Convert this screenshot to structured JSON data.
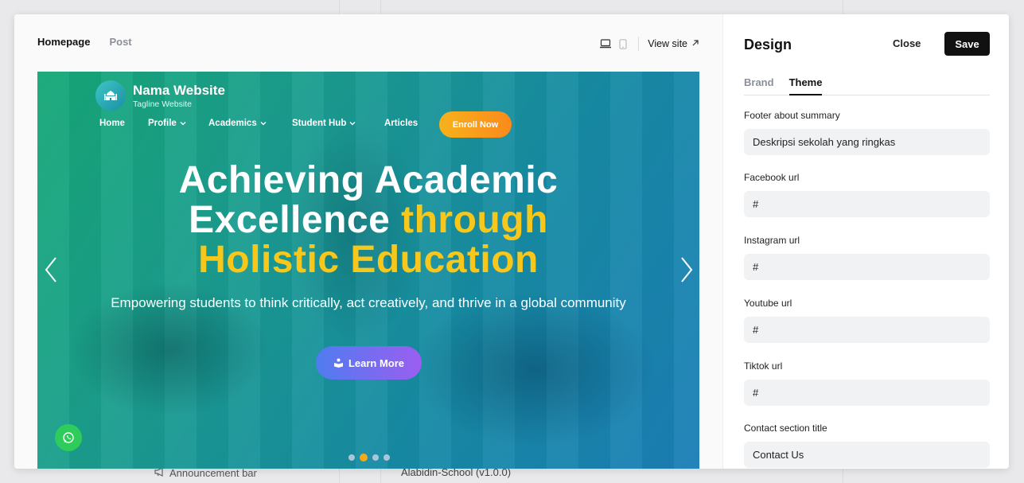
{
  "background": {
    "announcement_label": "Announcement bar",
    "version_text": "Alabidin-School (v1.0.0)"
  },
  "preview": {
    "tabs": [
      {
        "label": "Homepage",
        "active": true
      },
      {
        "label": "Post",
        "active": false
      }
    ],
    "view_site_label": "View site"
  },
  "hero": {
    "site_name": "Nama Website",
    "tagline": "Tagline Website",
    "nav": [
      {
        "label": "Home",
        "has_dropdown": false
      },
      {
        "label": "Profile",
        "has_dropdown": true
      },
      {
        "label": "Academics",
        "has_dropdown": true
      },
      {
        "label": "Student Hub",
        "has_dropdown": true
      },
      {
        "label": "Articles",
        "has_dropdown": false
      }
    ],
    "enroll_label": "Enroll Now",
    "headline_part1": "Achieving Academic",
    "headline_part2": "Excellence",
    "headline_highlight1": "through",
    "headline_highlight2": "Holistic Education",
    "subtext": "Empowering students to think critically, act creatively, and thrive in a global community",
    "learn_more_label": "Learn More",
    "slide_count": 4,
    "active_slide": 2,
    "colors": {
      "highlight": "#f7c71c",
      "enroll": "#f7a91c",
      "whatsapp": "#2ecc5a"
    }
  },
  "design": {
    "title": "Design",
    "close_label": "Close",
    "save_label": "Save",
    "tabs": [
      {
        "label": "Brand",
        "active": false
      },
      {
        "label": "Theme",
        "active": true
      }
    ],
    "fields": [
      {
        "label": "Footer about summary",
        "value": "Deskripsi sekolah yang ringkas"
      },
      {
        "label": "Facebook url",
        "value": "#"
      },
      {
        "label": "Instagram url",
        "value": "#"
      },
      {
        "label": "Youtube url",
        "value": "#"
      },
      {
        "label": "Tiktok url",
        "value": "#"
      },
      {
        "label": "Contact section title",
        "value": "Contact Us"
      }
    ]
  }
}
